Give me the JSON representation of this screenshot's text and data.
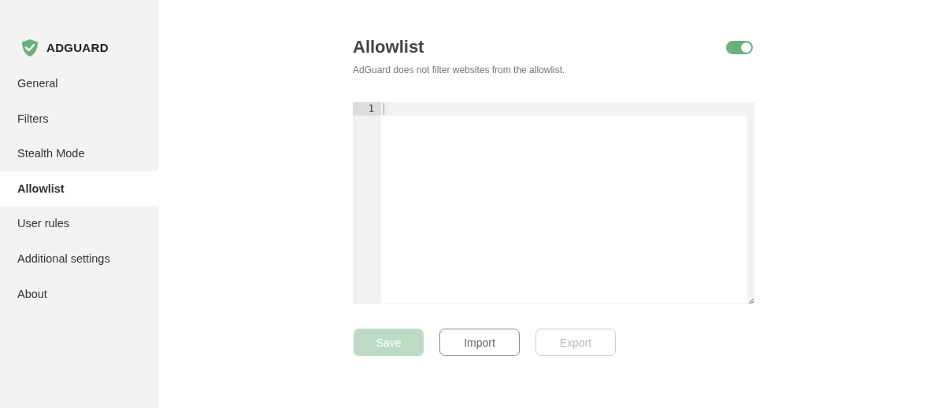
{
  "sidebar": {
    "logo": {
      "text": "ADGUARD"
    },
    "items": [
      {
        "label": "General",
        "selected": false
      },
      {
        "label": "Filters",
        "selected": false
      },
      {
        "label": "Stealth Mode",
        "selected": false
      },
      {
        "label": "Allowlist",
        "selected": true
      },
      {
        "label": "User rules",
        "selected": false
      },
      {
        "label": "Additional settings",
        "selected": false
      },
      {
        "label": "About",
        "selected": false
      }
    ]
  },
  "page": {
    "title": "Allowlist",
    "enabled": true,
    "description": "AdGuard does not filter websites from the allowlist."
  },
  "editor": {
    "line_numbers": [
      "1"
    ]
  },
  "buttons": [
    {
      "label": "Save",
      "kind": "primary",
      "disabled": true
    },
    {
      "label": "Import",
      "kind": "outline",
      "disabled": false
    },
    {
      "label": "Export",
      "kind": "outline",
      "disabled": true
    }
  ]
}
